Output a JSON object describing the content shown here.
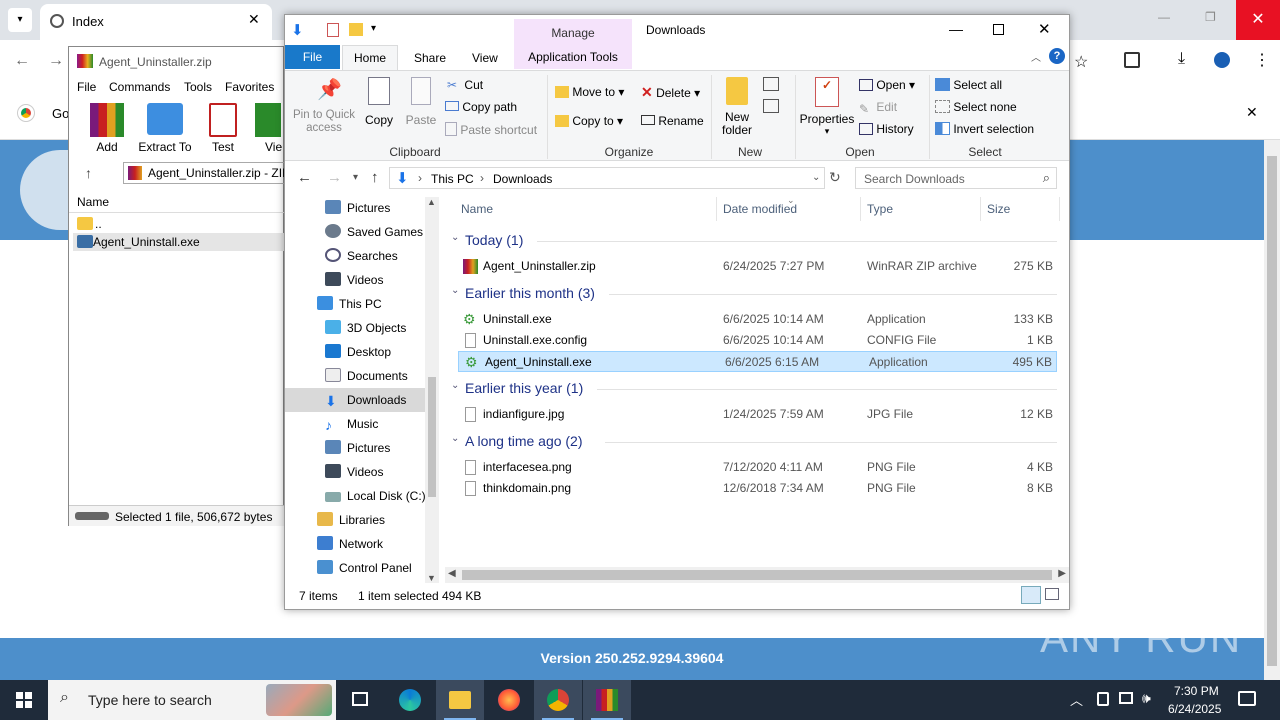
{
  "chrome": {
    "tab_title": "Index",
    "infobar_text": "Go",
    "version_text": "Version 250.252.9294.39604",
    "watermark": "ANY RUN"
  },
  "winrar": {
    "title": "Agent_Uninstaller.zip",
    "menu": [
      "File",
      "Commands",
      "Tools",
      "Favorites"
    ],
    "buttons": [
      "Add",
      "Extract To",
      "Test",
      "Vie"
    ],
    "path": "Agent_Uninstaller.zip - ZIP",
    "col_name": "Name",
    "items": [
      "..",
      "Agent_Uninstall.exe"
    ],
    "status": "Selected 1 file, 506,672 bytes"
  },
  "explorer": {
    "title": "Downloads",
    "manage": "Manage",
    "app_tools": "Application Tools",
    "tabs": {
      "file": "File",
      "home": "Home",
      "share": "Share",
      "view": "View"
    },
    "ribbon": {
      "pin": "Pin to Quick access",
      "copy": "Copy",
      "paste": "Paste",
      "cut": "Cut",
      "copy_path": "Copy path",
      "paste_shortcut": "Paste shortcut",
      "move_to": "Move to",
      "copy_to": "Copy to",
      "delete": "Delete",
      "rename": "Rename",
      "new_folder": "New folder",
      "properties": "Properties",
      "open": "Open",
      "edit": "Edit",
      "history": "History",
      "select_all": "Select all",
      "select_none": "Select none",
      "invert": "Invert selection"
    },
    "groups": {
      "clipboard": "Clipboard",
      "organize": "Organize",
      "new": "New",
      "open": "Open",
      "select": "Select"
    },
    "address": {
      "part1": "This PC",
      "part2": "Downloads",
      "search_placeholder": "Search Downloads"
    },
    "nav": [
      "Pictures",
      "Saved Games",
      "Searches",
      "Videos",
      "This PC",
      "3D Objects",
      "Desktop",
      "Documents",
      "Downloads",
      "Music",
      "Pictures",
      "Videos",
      "Local Disk (C:)",
      "Libraries",
      "Network",
      "Control Panel"
    ],
    "columns": {
      "name": "Name",
      "date": "Date modified",
      "type": "Type",
      "size": "Size"
    },
    "groups_list": [
      {
        "label": "Today (1)",
        "files": [
          {
            "name": "Agent_Uninstaller.zip",
            "date": "6/24/2025 7:27 PM",
            "type": "WinRAR ZIP archive",
            "size": "275 KB"
          }
        ]
      },
      {
        "label": "Earlier this month (3)",
        "files": [
          {
            "name": "Uninstall.exe",
            "date": "6/6/2025 10:14 AM",
            "type": "Application",
            "size": "133 KB"
          },
          {
            "name": "Uninstall.exe.config",
            "date": "6/6/2025 10:14 AM",
            "type": "CONFIG File",
            "size": "1 KB"
          },
          {
            "name": "Agent_Uninstall.exe",
            "date": "6/6/2025 6:15 AM",
            "type": "Application",
            "size": "495 KB"
          }
        ]
      },
      {
        "label": "Earlier this year (1)",
        "files": [
          {
            "name": "indianfigure.jpg",
            "date": "1/24/2025 7:59 AM",
            "type": "JPG File",
            "size": "12 KB"
          }
        ]
      },
      {
        "label": "A long time ago (2)",
        "files": [
          {
            "name": "interfacesea.png",
            "date": "7/12/2020 4:11 AM",
            "type": "PNG File",
            "size": "4 KB"
          },
          {
            "name": "thinkdomain.png",
            "date": "12/6/2018 7:34 AM",
            "type": "PNG File",
            "size": "8 KB"
          }
        ]
      }
    ],
    "status": {
      "count": "7 items",
      "selected": "1 item selected",
      "size": "494 KB"
    }
  },
  "taskbar": {
    "search_placeholder": "Type here to search",
    "time": "7:30 PM",
    "date": "6/24/2025"
  }
}
